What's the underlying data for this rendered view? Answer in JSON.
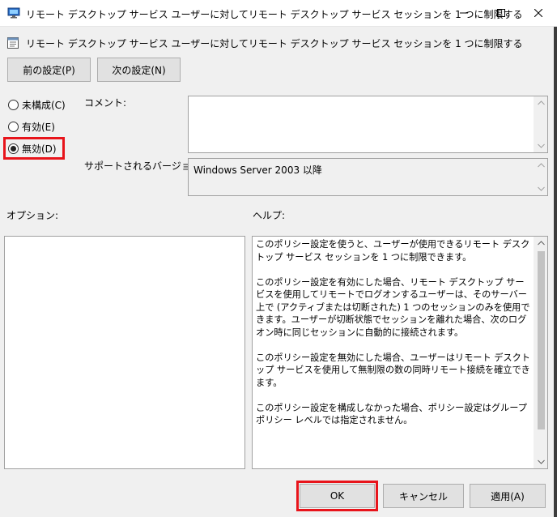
{
  "window": {
    "title": "リモート デスクトップ サービス ユーザーに対してリモート デスクトップ サービス セッションを 1 つに制限する"
  },
  "header": {
    "policy_title": "リモート デスクトップ サービス ユーザーに対してリモート デスクトップ サービス セッションを 1 つに制限する"
  },
  "nav": {
    "prev_label": "前の設定(P)",
    "next_label": "次の設定(N)"
  },
  "state": {
    "options": [
      {
        "label": "未構成(C)",
        "checked": false
      },
      {
        "label": "有効(E)",
        "checked": false
      },
      {
        "label": "無効(D)",
        "checked": true
      }
    ]
  },
  "comment": {
    "label": "コメント:",
    "value": ""
  },
  "supported": {
    "label": "サポートされるバージョン:",
    "value": "Windows Server 2003 以降"
  },
  "options_section": {
    "label": "オプション:"
  },
  "help_section": {
    "label": "ヘルプ:",
    "paragraphs": [
      "このポリシー設定を使うと、ユーザーが使用できるリモート デスクトップ サービス セッションを 1 つに制限できます。",
      "このポリシー設定を有効にした場合、リモート デスクトップ サービスを使用してリモートでログオンするユーザーは、そのサーバー上で (アクティブまたは切断された) 1 つのセッションのみを使用できます。ユーザーが切断状態でセッションを離れた場合、次のログオン時に同じセッションに自動的に接続されます。",
      "このポリシー設定を無効にした場合、ユーザーはリモート デスクトップ サービスを使用して無制限の数の同時リモート接続を確立できます。",
      "このポリシー設定を構成しなかった場合、ポリシー設定はグループ ポリシー レベルでは指定されません。"
    ]
  },
  "footer": {
    "ok_label": "OK",
    "cancel_label": "キャンセル",
    "apply_label": "適用(A)"
  },
  "colors": {
    "highlight": "#e8141b"
  },
  "icons": {
    "app": "remote-desktop-icon",
    "policy": "policy-setting-icon",
    "minimize": "minimize-icon",
    "maximize": "maximize-icon",
    "close": "close-icon"
  }
}
